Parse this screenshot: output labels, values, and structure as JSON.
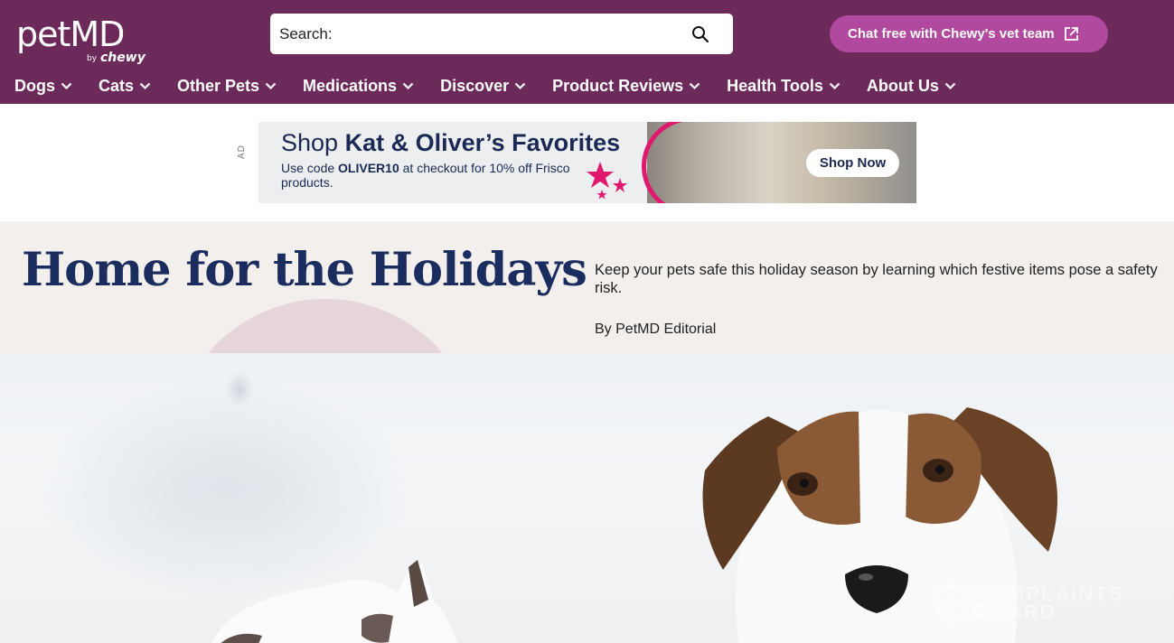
{
  "header": {
    "logo_main": "petMD",
    "logo_by": "by",
    "logo_brand": "chewy",
    "search_label": "Search:",
    "search_placeholder": "",
    "chat_button": "Chat free with Chewy's vet team",
    "background_color": "#6b2a5a",
    "accent_color": "#b14a9e"
  },
  "nav": {
    "items": [
      {
        "label": "Dogs"
      },
      {
        "label": "Cats"
      },
      {
        "label": "Other Pets"
      },
      {
        "label": "Medications"
      },
      {
        "label": "Discover"
      },
      {
        "label": "Product Reviews"
      },
      {
        "label": "Health Tools"
      },
      {
        "label": "About Us"
      }
    ]
  },
  "ad": {
    "tag": "AD",
    "title_prefix": "Shop",
    "title_bold": "Kat & Oliver’s Favorites",
    "subtitle_prefix": "Use code",
    "subtitle_code": "OLIVER10",
    "subtitle_rest": "at checkout for 10% off Frisco products.",
    "cta": "Shop Now"
  },
  "hero": {
    "title": "Home for the Holidays",
    "description": "Keep your pets safe this holiday season by learning which festive items pose a safety risk.",
    "author": "By PetMD Editorial",
    "title_color": "#1b2d5e"
  },
  "watermark": {
    "line1": "COMPLAINTS",
    "line2": "BOARD"
  }
}
